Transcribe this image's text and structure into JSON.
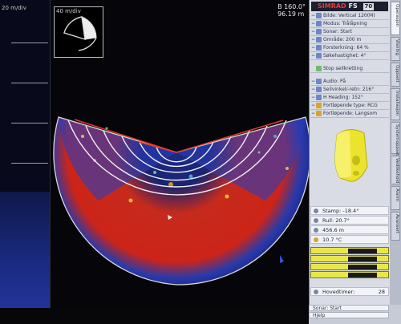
{
  "left_panel": {
    "header": "20 m/div"
  },
  "mini_view": {
    "label": "40 m/div"
  },
  "readout": {
    "line1": "B 160.0°",
    "line2": "96.19 m"
  },
  "brand": {
    "name": "SIMRAD",
    "model": "FS",
    "model_badge": "70"
  },
  "settings": {
    "rows": [
      {
        "label": "Bilde: Vertical 120(M)"
      },
      {
        "label": "Modus: Trålåpning"
      },
      {
        "label": "Sonar: Start"
      },
      {
        "label": "Område: 200 m"
      },
      {
        "label": "Forsterkning: 64 %"
      },
      {
        "label": "Søkehastighet: 4°"
      }
    ],
    "rows2": [
      {
        "label": "Stop seilkretting"
      }
    ],
    "rows3": [
      {
        "label": "Audio: På"
      },
      {
        "label": "Seilvinkel/-retn: 216°"
      },
      {
        "label": "H Heading: 152°"
      },
      {
        "label": "Fortløpende type: RCG"
      },
      {
        "label": "Fortløpende: Langsom"
      }
    ]
  },
  "measurements": {
    "pitch": "Stamp: -18.4°",
    "roll": "Rull: 20.7°",
    "depth": "456.6 m",
    "temp": "10.7 °C"
  },
  "gauges": {
    "bar1": "",
    "bar2": "",
    "bar3": "",
    "bar4": ""
  },
  "timer": {
    "label": "Hovedtimer:",
    "value": "28"
  },
  "bottom": {
    "btn1": "Sonar: Start",
    "btn2": "Hjelp"
  },
  "tabs": [
    "Operasjon",
    "Visning",
    "Oppsett",
    "Installasjon",
    "Systemoppsett",
    "Vedlikehold",
    "Alarm",
    "Avansert"
  ]
}
